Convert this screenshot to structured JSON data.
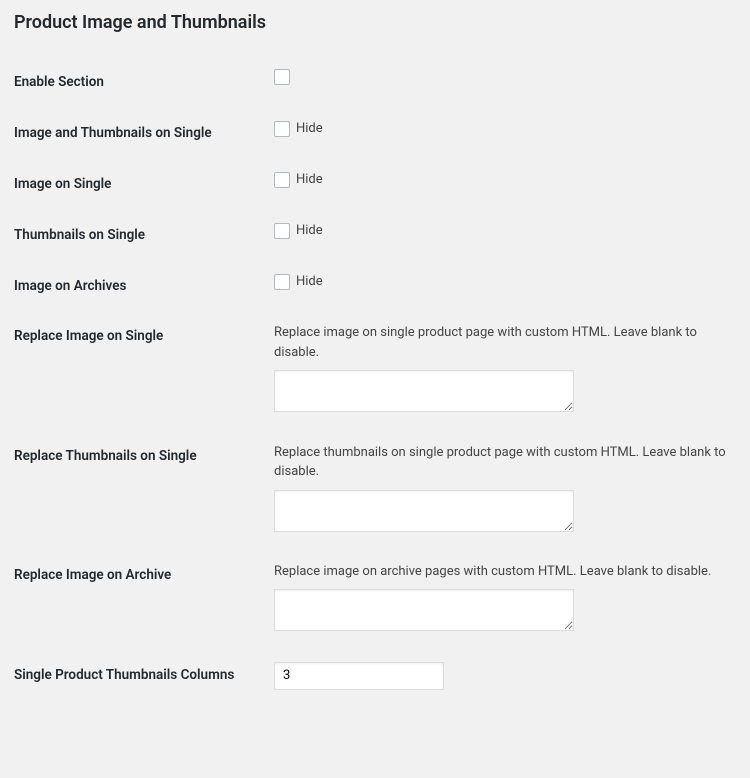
{
  "section_title": "Product Image and Thumbnails",
  "rows": {
    "enable_section": {
      "label": "Enable Section",
      "checkbox_text": ""
    },
    "image_thumbs_single": {
      "label": "Image and Thumbnails on Single",
      "checkbox_text": "Hide"
    },
    "image_single": {
      "label": "Image on Single",
      "checkbox_text": "Hide"
    },
    "thumbs_single": {
      "label": "Thumbnails on Single",
      "checkbox_text": "Hide"
    },
    "image_archives": {
      "label": "Image on Archives",
      "checkbox_text": "Hide"
    },
    "replace_image_single": {
      "label": "Replace Image on Single",
      "desc": "Replace image on single product page with custom HTML. Leave blank to disable.",
      "value": ""
    },
    "replace_thumbs_single": {
      "label": "Replace Thumbnails on Single",
      "desc": "Replace thumbnails on single product page with custom HTML. Leave blank to disable.",
      "value": ""
    },
    "replace_image_archive": {
      "label": "Replace Image on Archive",
      "desc": "Replace image on archive pages with custom HTML. Leave blank to disable.",
      "value": ""
    },
    "thumbs_columns": {
      "label": "Single Product Thumbnails Columns",
      "value": "3"
    }
  }
}
